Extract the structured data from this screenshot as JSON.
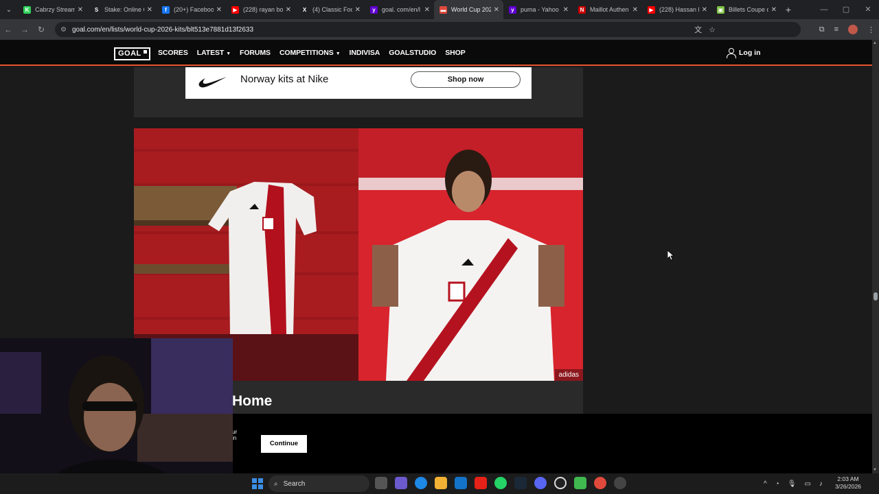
{
  "browser": {
    "tabs": [
      {
        "title": "Cabrzy Stream",
        "favicon_color": "#2fd35c",
        "favicon_glyph": "K"
      },
      {
        "title": "Stake: Online C",
        "favicon_color": "#202124",
        "favicon_glyph": "S"
      },
      {
        "title": "(20+) Faceboo",
        "favicon_color": "#1877f2",
        "favicon_glyph": "f"
      },
      {
        "title": "(228) rayan bo",
        "favicon_color": "#ff0000",
        "favicon_glyph": "▶"
      },
      {
        "title": "(4) Classic Foo",
        "favicon_color": "#202124",
        "favicon_glyph": "X"
      },
      {
        "title": "goal. com/en/l",
        "favicon_color": "#6001d2",
        "favicon_glyph": "y"
      },
      {
        "title": "World Cup 202",
        "favicon_color": "#e0493c",
        "favicon_glyph": "▬",
        "active": true
      },
      {
        "title": "puma - Yahoo",
        "favicon_color": "#6001d2",
        "favicon_glyph": "y"
      },
      {
        "title": "Maillot Authen",
        "favicon_color": "#cc0000",
        "favicon_glyph": "N"
      },
      {
        "title": "(228) Hassan E",
        "favicon_color": "#ff0000",
        "favicon_glyph": "▶"
      },
      {
        "title": "Billets Coupe d",
        "favicon_color": "#7cc242",
        "favicon_glyph": "▣"
      }
    ],
    "url": "goal.com/en/lists/world-cup-2026-kits/blt513e7881d13f2633"
  },
  "site": {
    "logo": "GOAL",
    "nav": [
      {
        "label": "SCORES",
        "dropdown": false
      },
      {
        "label": "LATEST",
        "dropdown": true
      },
      {
        "label": "FORUMS",
        "dropdown": false
      },
      {
        "label": "COMPETITIONS",
        "dropdown": true
      },
      {
        "label": "INDIVISA",
        "dropdown": false
      },
      {
        "label": "GOALSTUDIO",
        "dropdown": false
      },
      {
        "label": "SHOP",
        "dropdown": false
      }
    ],
    "login_label": "Log in"
  },
  "article": {
    "shop_title": "Norway kits at Nike",
    "shop_button": "Shop now",
    "image_credit": "adidas",
    "heading_partial": "Home"
  },
  "consent": {
    "text_fragment_1": "ur",
    "text_fragment_2": "in",
    "continue_label": "Continue"
  },
  "taskbar": {
    "search_label": "Search",
    "time": "2:03 AM",
    "date": "3/26/2026"
  }
}
